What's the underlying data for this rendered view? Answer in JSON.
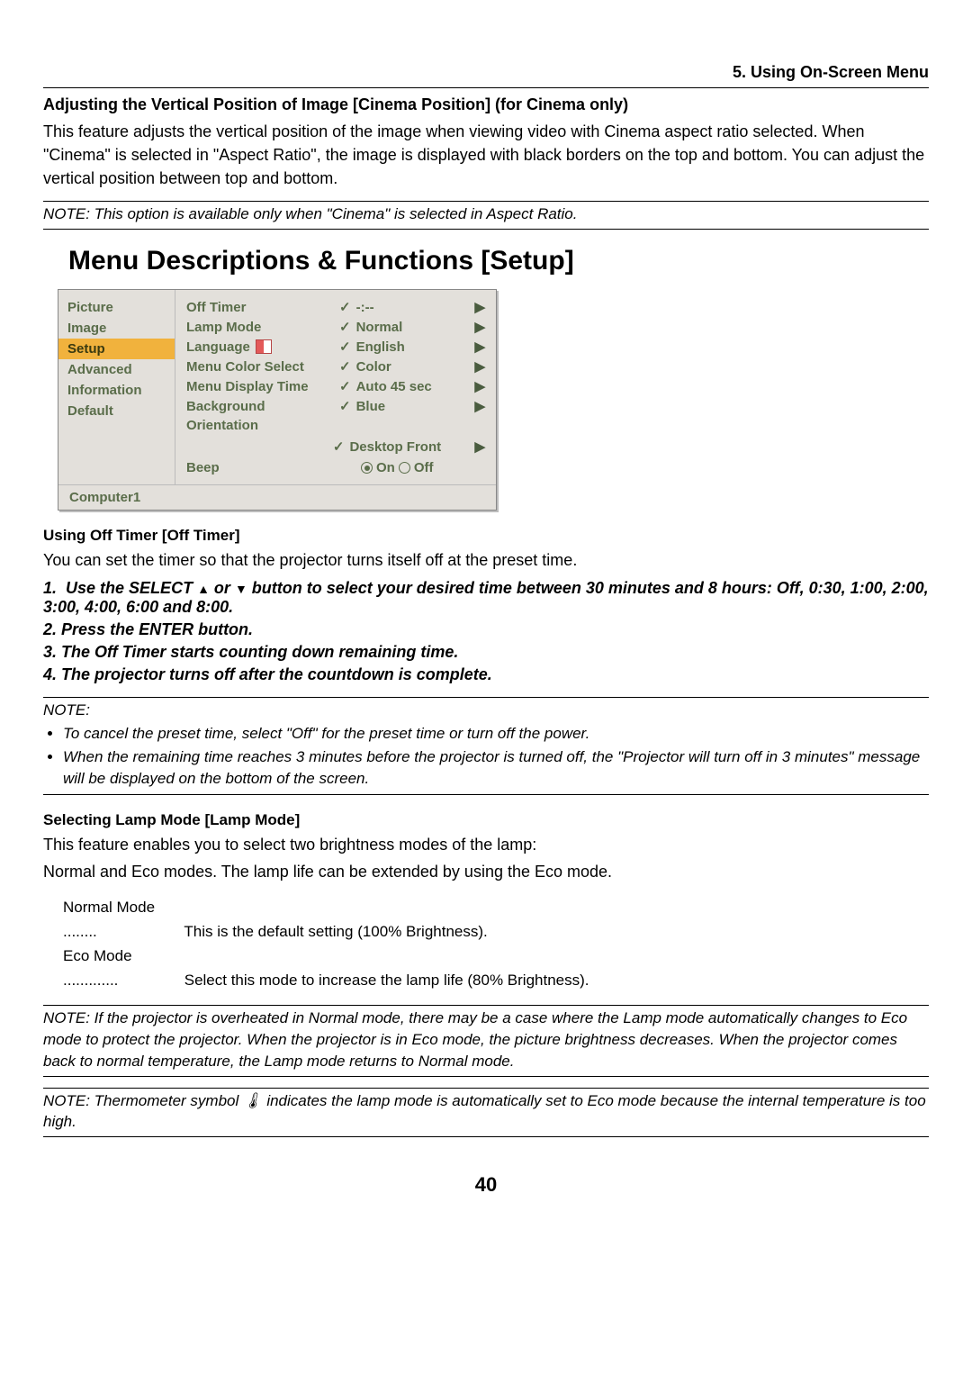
{
  "breadcrumb": "5. Using On-Screen Menu",
  "cinema": {
    "heading": "Adjusting the Vertical Position of Image [Cinema Position] (for Cinema only)",
    "p1": "This feature adjusts the vertical position of the image when viewing video with Cinema aspect ratio selected. When \"Cinema\" is selected in \"Aspect Ratio\", the image is displayed with black borders on the top and bottom. You can adjust the vertical position between top and bottom.",
    "note": "NOTE: This option is available only when \"Cinema\" is selected in Aspect Ratio."
  },
  "setup_heading": "Menu Descriptions & Functions [Setup]",
  "osd": {
    "nav": [
      "Picture",
      "Image",
      "Setup",
      "Advanced",
      "Information",
      "Default"
    ],
    "nav_active_index": 2,
    "rows": {
      "off_timer": {
        "label": "Off Timer",
        "value": "-:--"
      },
      "lamp_mode": {
        "label": "Lamp Mode",
        "value": "Normal"
      },
      "language": {
        "label": "Language",
        "value": "English"
      },
      "menu_color": {
        "label": "Menu Color Select",
        "value": "Color"
      },
      "menu_display": {
        "label": "Menu Display Time",
        "value": "Auto 45 sec"
      },
      "background": {
        "label": "Background",
        "value": "Blue"
      },
      "orientation": {
        "label": "Orientation",
        "value": "Desktop Front"
      },
      "beep": {
        "label": "Beep",
        "on": "On",
        "off": "Off",
        "selected": "on"
      }
    },
    "footer": "Computer1"
  },
  "off_timer": {
    "heading": "Using Off Timer [Off Timer]",
    "p1": "You can set the timer so that the projector turns itself off at the preset time.",
    "steps_prefix": [
      "1.",
      "2.",
      "3.",
      "4."
    ],
    "step1a": "Use the SELECT ",
    "step1b": " or ",
    "step1c": " button to select your desired time between 30 minutes and 8 hours: Off, 0:30, 1:00, 2:00, 3:00, 4:00, 6:00 and 8:00.",
    "step2": "Press the ENTER button.",
    "step3": "The Off Timer starts counting down remaining time.",
    "step4": "The projector turns off after the countdown is complete.",
    "note_label": "NOTE:",
    "note_b1": "To cancel the preset time, select \"Off\" for the preset time or turn off the power.",
    "note_b2": "When the remaining time reaches 3 minutes before the projector is turned off, the \"Projector will turn off in 3 minutes\" message will be displayed on the bottom of the screen."
  },
  "lamp": {
    "heading": "Selecting Lamp Mode [Lamp Mode]",
    "p1": "This feature enables you to select two brightness modes of the lamp:",
    "p2": "Normal and Eco modes. The lamp life can be extended by using the Eco mode.",
    "normal_label": "Normal Mode ........",
    "normal_desc": "This is the default setting (100% Brightness).",
    "eco_label": "Eco Mode .............",
    "eco_desc": "Select this mode to increase the lamp life (80% Brightness).",
    "note1": "NOTE: If the projector is overheated in Normal mode, there may be a case where the Lamp mode automatically changes to Eco mode to protect the projector. When the projector is in Eco mode, the picture brightness decreases. When the projector comes back to normal temperature, the Lamp mode returns to Normal mode.",
    "note2a": "NOTE: Thermometer symbol ",
    "note2b": " indicates the lamp mode is automatically set to Eco mode because the internal temperature is too high."
  },
  "page_number": "40"
}
